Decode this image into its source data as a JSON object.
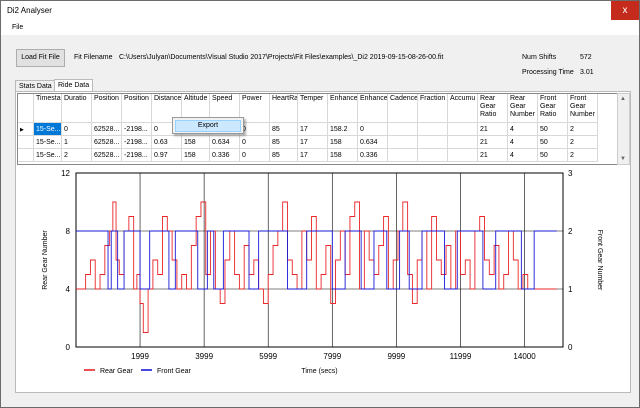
{
  "window": {
    "title": "Di2 Analyser",
    "close_label": "x"
  },
  "menu": {
    "file": "File"
  },
  "toolbar": {
    "load_button": "Load Fit File",
    "filename_label": "Fit Filename",
    "filename_value": "C:\\Users\\Julyan\\Documents\\Visual Studio 2017\\Projects\\Fit Files\\examples\\_Di2 2019-09-15-08-26-00.fit",
    "num_shifts_label": "Num Shifts",
    "num_shifts_value": "572",
    "processing_time_label": "Processing Time",
    "processing_time_value": "3.01"
  },
  "tabs": [
    {
      "label": "Stats Data"
    },
    {
      "label": "Ride Data"
    }
  ],
  "grid": {
    "columns": [
      "Timestar",
      "Duratio",
      "Position",
      "Position",
      "Distance",
      "Altitude",
      "Speed",
      "Power",
      "HeartRa",
      "Temper",
      "Enhance",
      "Enhance",
      "Cadence",
      "Fraction",
      "Accumu",
      "Rear Gear Ratio",
      "Rear Gear Number",
      "Front Gear Ratio",
      "Front Gear Number"
    ],
    "rows": [
      [
        "15-Se...",
        "0",
        "62528...",
        "-2198...",
        "0",
        "",
        "",
        "0",
        "85",
        "17",
        "158.2",
        "0",
        "",
        "",
        "",
        "21",
        "4",
        "50",
        "2"
      ],
      [
        "15-Se...",
        "1",
        "62528...",
        "-2198...",
        "0.63",
        "158",
        "0.634",
        "0",
        "85",
        "17",
        "158",
        "0.634",
        "",
        "",
        "",
        "21",
        "4",
        "50",
        "2"
      ],
      [
        "15-Se...",
        "2",
        "62528...",
        "-2198...",
        "0.97",
        "158",
        "0.336",
        "0",
        "85",
        "17",
        "158",
        "0.336",
        "",
        "",
        "",
        "21",
        "4",
        "50",
        "2"
      ]
    ]
  },
  "context_menu": {
    "export": "Export"
  },
  "chart_data": {
    "type": "line",
    "xlabel": "Time (secs)",
    "ylabel": "Rear Gear Number",
    "y2label": "Front Gear Number",
    "ylim": [
      0,
      12
    ],
    "y2lim": [
      0,
      3
    ],
    "yticks": [
      0,
      4,
      8,
      12
    ],
    "y2ticks": [
      0,
      1,
      2,
      3
    ],
    "xlim": [
      0,
      15200
    ],
    "xticks": [
      1999,
      3999,
      5999,
      7999,
      9999,
      11999,
      14000
    ],
    "grid": true,
    "legend_position": "bottom-left",
    "series": [
      {
        "name": "Rear Gear",
        "axis": "left",
        "color": "#e8262a",
        "x": [
          0,
          150,
          300,
          450,
          600,
          750,
          900,
          1050,
          1150,
          1250,
          1350,
          1500,
          1650,
          1800,
          1900,
          2000,
          2100,
          2250,
          2400,
          2550,
          2700,
          2850,
          3000,
          3150,
          3300,
          3450,
          3600,
          3750,
          3900,
          4050,
          4200,
          4350,
          4500,
          4650,
          4800,
          4950,
          5100,
          5250,
          5400,
          5550,
          5700,
          5850,
          6000,
          6150,
          6300,
          6450,
          6600,
          6750,
          6900,
          7050,
          7200,
          7350,
          7500,
          7650,
          7800,
          7950,
          8100,
          8250,
          8400,
          8550,
          8700,
          8850,
          9000,
          9150,
          9300,
          9450,
          9600,
          9750,
          9900,
          10050,
          10200,
          10350,
          10500,
          10650,
          10800,
          10950,
          11100,
          11250,
          11400,
          11550,
          11700,
          11850,
          12000,
          12150,
          12300,
          12450,
          12600,
          12750,
          12900,
          13050,
          13200,
          13350,
          13500,
          13650,
          13800,
          13950,
          14100,
          14250,
          14400,
          14550,
          14700,
          14850,
          15000
        ],
        "values": [
          4,
          4,
          5,
          6,
          4,
          5,
          7,
          8,
          10,
          6,
          5,
          8,
          9,
          4,
          5,
          3,
          1,
          4,
          6,
          5,
          9,
          8,
          6,
          4,
          5,
          4,
          7,
          9,
          10,
          5,
          8,
          4,
          3,
          6,
          8,
          5,
          4,
          7,
          5,
          6,
          4,
          3,
          5,
          7,
          8,
          10,
          6,
          5,
          4,
          8,
          6,
          9,
          4,
          5,
          7,
          3,
          6,
          8,
          5,
          9,
          10,
          4,
          8,
          6,
          5,
          7,
          9,
          4,
          6,
          8,
          10,
          5,
          3,
          6,
          8,
          4,
          9,
          6,
          5,
          7,
          4,
          8,
          5,
          6,
          4,
          8,
          9,
          6,
          5,
          7,
          4,
          5,
          8,
          6,
          4,
          5,
          4,
          4,
          4,
          4,
          4,
          4,
          4
        ]
      },
      {
        "name": "Front Gear",
        "axis": "right",
        "color": "#1a1ad6",
        "x": [
          0,
          800,
          1000,
          1100,
          1300,
          1500,
          1700,
          2000,
          2300,
          2500,
          2900,
          3100,
          3500,
          3800,
          4100,
          4300,
          4600,
          5000,
          5400,
          5700,
          6200,
          6600,
          7200,
          7500,
          8000,
          8400,
          8900,
          9300,
          9700,
          10100,
          10400,
          10800,
          11200,
          11500,
          11900,
          12300,
          12700,
          13100,
          13500,
          13900,
          14300,
          14700,
          15000
        ],
        "values": [
          2,
          2,
          1,
          2,
          1,
          2,
          2,
          1,
          2,
          2,
          1,
          2,
          2,
          1,
          2,
          1,
          2,
          2,
          1,
          2,
          2,
          1,
          2,
          2,
          1,
          2,
          1,
          2,
          1,
          2,
          1,
          2,
          2,
          1,
          2,
          2,
          1,
          2,
          2,
          1,
          2,
          2,
          2
        ]
      }
    ]
  }
}
